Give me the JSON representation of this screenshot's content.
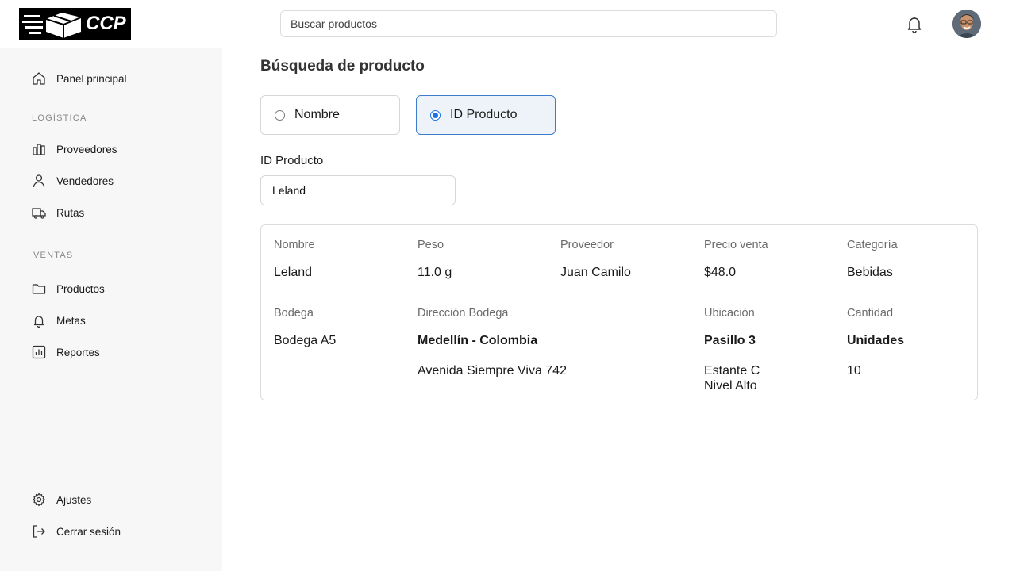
{
  "header": {
    "logo_text": "CCP",
    "search_placeholder": "Buscar productos"
  },
  "sidebar": {
    "home": "Panel principal",
    "section_logistica": "LOGÍSTICA",
    "proveedores": "Proveedores",
    "vendedores": "Vendedores",
    "rutas": "Rutas",
    "section_ventas": "VENTAS",
    "productos": "Productos",
    "metas": "Metas",
    "reportes": "Reportes",
    "ajustes": "Ajustes",
    "cerrar_sesion": "Cerrar sesión"
  },
  "main": {
    "title": "Búsqueda de producto",
    "options": {
      "nombre": "Nombre",
      "id_producto": "ID Producto",
      "selected": "ID Producto"
    },
    "field_label": "ID Producto",
    "field_value": "Leland"
  },
  "result": {
    "headers1": {
      "nombre": "Nombre",
      "peso": "Peso",
      "proveedor": "Proveedor",
      "precio": "Precio venta",
      "categoria": "Categoría"
    },
    "values1": {
      "nombre": "Leland",
      "peso": "11.0 g",
      "proveedor": "Juan Camilo",
      "precio": "$48.0",
      "categoria": "Bebidas"
    },
    "headers2": {
      "bodega": "Bodega",
      "direccion": "Dirección Bodega",
      "ubicacion": "Ubicación",
      "cantidad": "Cantidad"
    },
    "values2": {
      "bodega": "Bodega A5",
      "direccion_ciudad": "Medellín - Colombia",
      "direccion_calle": "Avenida Siempre Viva 742",
      "ubicacion_pasillo": "Pasillo 3",
      "ubicacion_estante": "Estante C",
      "ubicacion_nivel": "Nivel Alto",
      "cantidad_unidad": "Unidades",
      "cantidad_valor": "10"
    }
  }
}
